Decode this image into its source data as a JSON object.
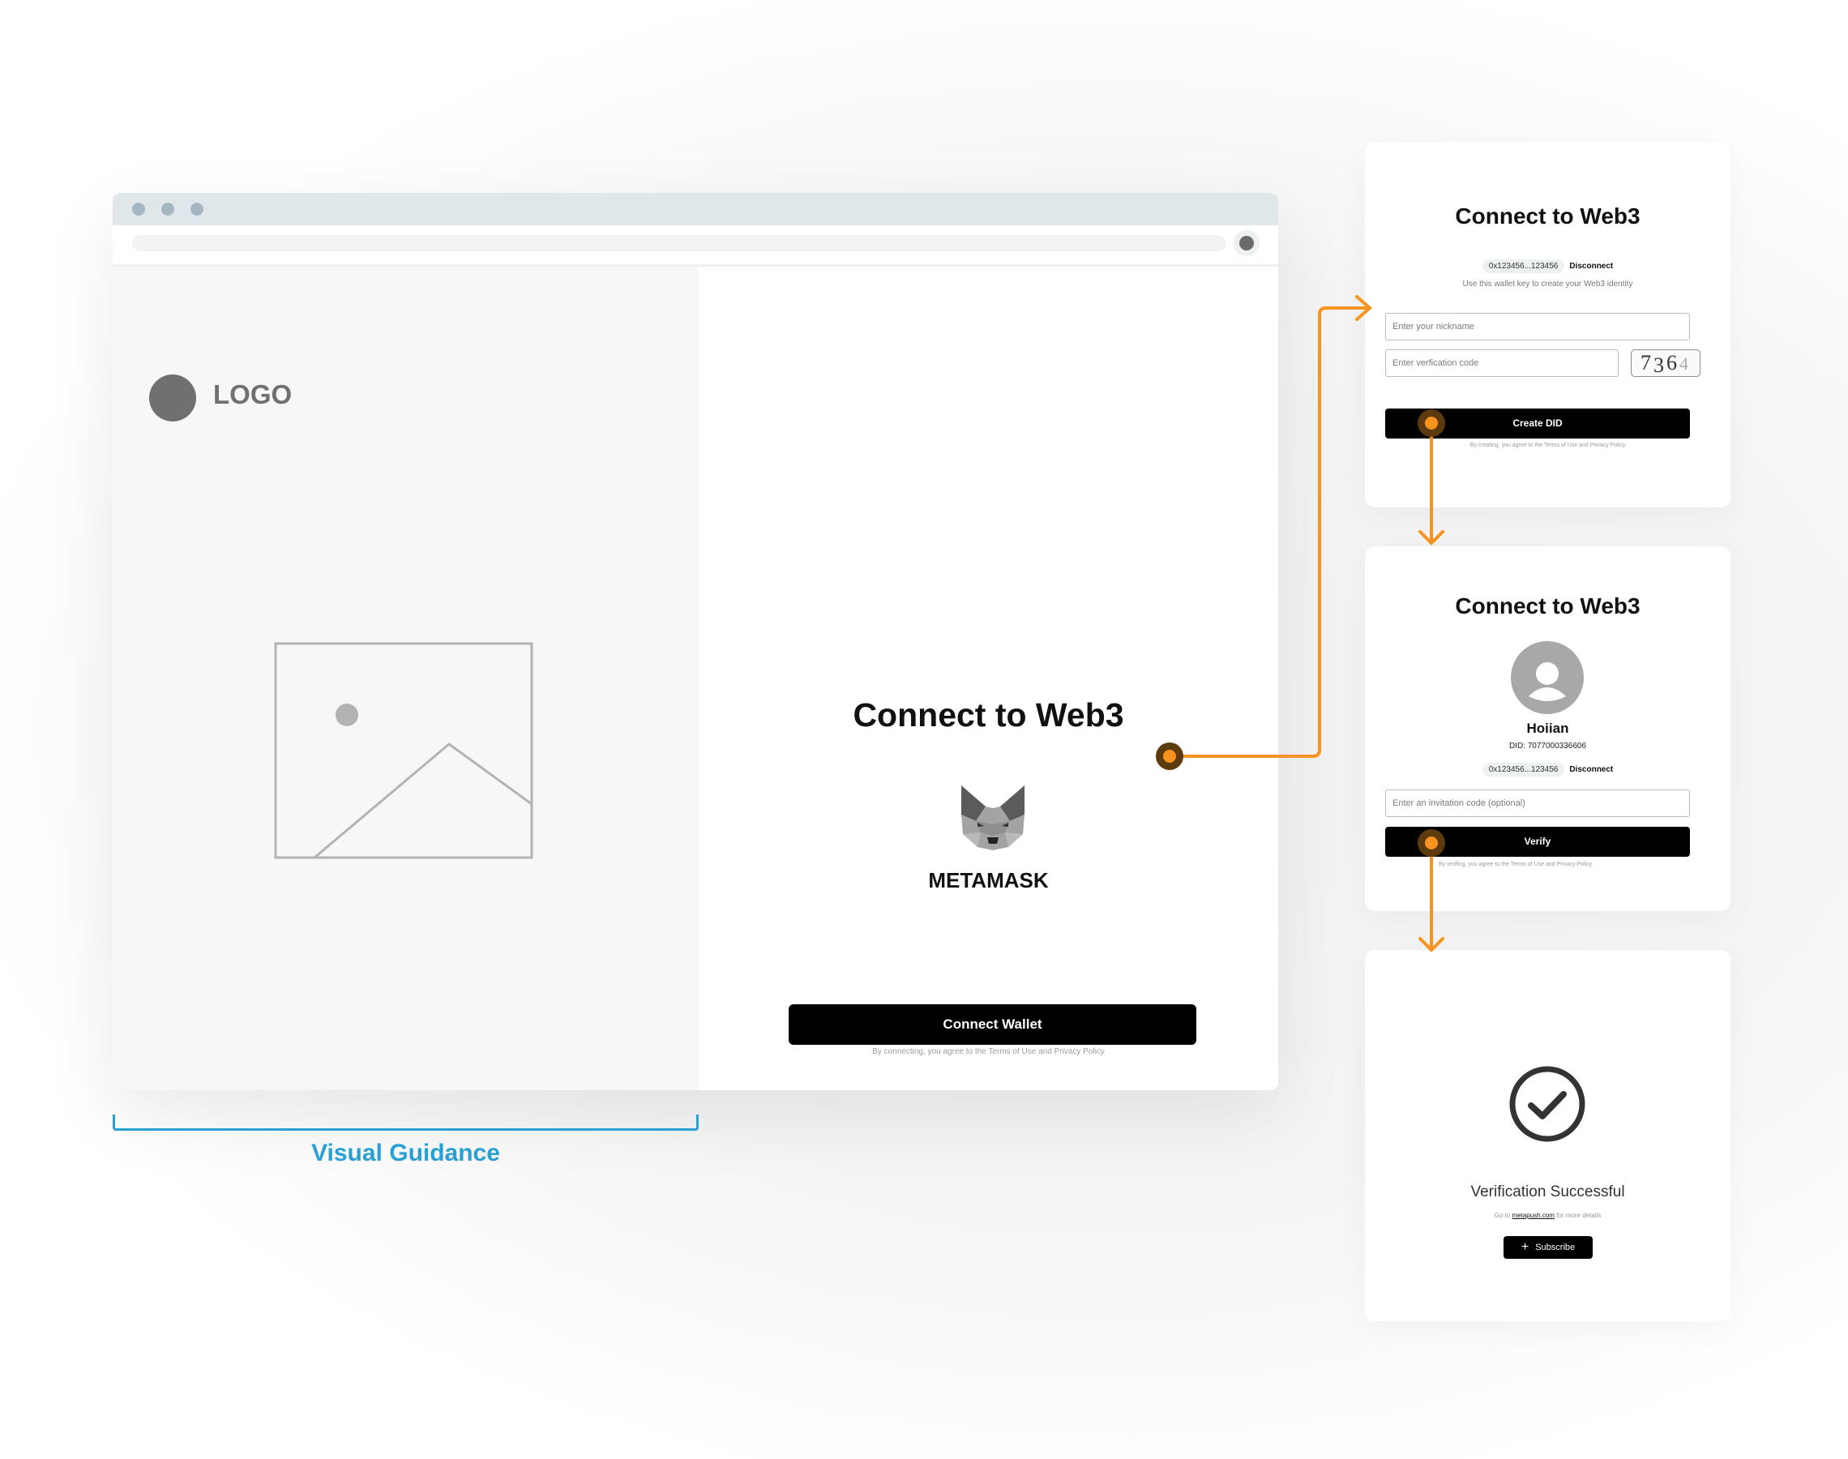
{
  "colors": {
    "accent_orange": "#f7931e",
    "guidance_blue": "#2a9fd4",
    "button_black": "#000000"
  },
  "browser": {
    "logo_text": "LOGO",
    "main": {
      "title": "Connect to Web3",
      "wallet_icon": "metamask-fox-icon",
      "wallet_name": "METAMASK",
      "connect_button": "Connect Wallet",
      "fine_print": "By connecting, you agree to the Terms of Use and Privacy Policy"
    }
  },
  "guidance": {
    "label": "Visual Guidance"
  },
  "cards": {
    "create_did": {
      "title": "Connect to Web3",
      "wallet_address": "0x123456...123456",
      "disconnect_label": "Disconnect",
      "hint": "Use this wallet key to create your Web3 identity",
      "nickname_placeholder": "Enter your nickname",
      "verification_placeholder": "Enter verfication code",
      "captcha_digits": [
        "7",
        "3",
        "6",
        "4"
      ],
      "button": "Create DID",
      "fine_print": "By creating, you agree to the Terms of Use and Privacy Policy"
    },
    "verify": {
      "title": "Connect to Web3",
      "avatar_icon": "user-avatar-icon",
      "user_name": "Hoiian",
      "did": "DID: 7077000336606",
      "wallet_address": "0x123456...123456",
      "disconnect_label": "Disconnect",
      "invitation_placeholder": "Enter an invitation code (optional)",
      "button": "Verify",
      "fine_print": "By verifing, you agree to the Terms of Use and Privacy Policy"
    },
    "success": {
      "icon": "check-circle-icon",
      "title": "Verification Successful",
      "goto_prefix": "Go to",
      "goto_link": "metapush.com",
      "goto_suffix": "for more details",
      "subscribe_button": "Subscribe"
    }
  }
}
